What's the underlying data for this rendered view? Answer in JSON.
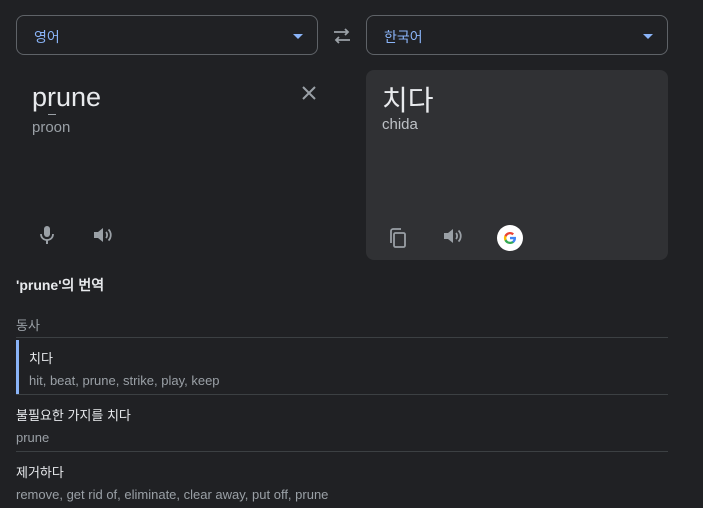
{
  "source_lang": {
    "label": "영어"
  },
  "target_lang": {
    "label": "한국어"
  },
  "source": {
    "text": "prune",
    "translit": "proon"
  },
  "target": {
    "text": "치다",
    "translit": "chida"
  },
  "dictionary": {
    "title": "'prune'의 번역",
    "part_of_speech": "동사",
    "entries": [
      {
        "term": "치다",
        "synonyms": "hit, beat, prune, strike, play, keep"
      },
      {
        "term": "불필요한 가지를 치다",
        "synonyms": "prune"
      },
      {
        "term": "제거하다",
        "synonyms": "remove, get rid of, eliminate, clear away, put off, prune"
      }
    ]
  },
  "colors": {
    "accent": "#8ab4f8",
    "background": "#202124",
    "panel": "#303134"
  },
  "icons": [
    "swap-icon",
    "close-icon",
    "mic-icon",
    "speaker-icon",
    "copy-icon",
    "google-logo-icon",
    "chevron-down-icon"
  ]
}
